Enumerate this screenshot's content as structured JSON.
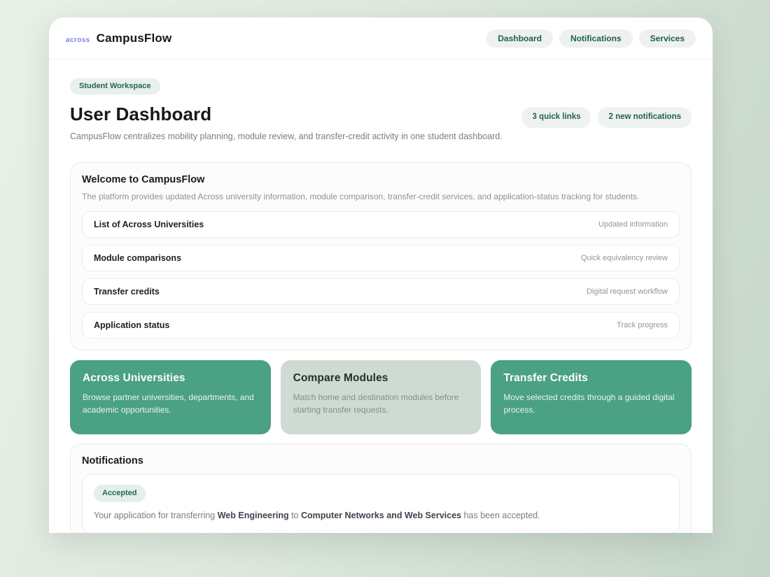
{
  "theme": {
    "accent_green": "#4aa183",
    "muted_sage": "#cedbd2",
    "pill_text": "#1f5f52",
    "page_background_start": "#e9f0e7",
    "page_background_end": "#c4d5c8"
  },
  "header": {
    "logo_mark": "across",
    "logo_title": "CampusFlow",
    "nav": [
      {
        "label": "Dashboard"
      },
      {
        "label": "Notifications"
      },
      {
        "label": "Services"
      }
    ]
  },
  "hero": {
    "workspace_badge": "Student Workspace",
    "title": "User Dashboard",
    "subtitle": "CampusFlow centralizes mobility planning, module review, and transfer-credit activity in one student dashboard.",
    "badges": [
      {
        "label": "3 quick links"
      },
      {
        "label": "2 new notifications"
      }
    ]
  },
  "welcome": {
    "title": "Welcome to CampusFlow",
    "description": "The platform provides updated Across university information, module comparison, transfer-credit services, and application-status tracking for students.",
    "items": [
      {
        "label": "List of Across Universities",
        "meta": "Updated information"
      },
      {
        "label": "Module comparisons",
        "meta": "Quick equivalency review"
      },
      {
        "label": "Transfer credits",
        "meta": "Digital request workflow"
      },
      {
        "label": "Application status",
        "meta": "Track progress"
      }
    ]
  },
  "feature_cards": [
    {
      "title": "Across Universities",
      "description": "Browse partner universities, departments, and academic opportunities.",
      "variant": "solid"
    },
    {
      "title": "Compare Modules",
      "description": "Match home and destination modules before starting transfer requests.",
      "variant": "muted"
    },
    {
      "title": "Transfer Credits",
      "description": "Move selected credits through a guided digital process.",
      "variant": "solid"
    }
  ],
  "notifications": {
    "title": "Notifications",
    "items": [
      {
        "status": "Accepted",
        "message_parts": [
          {
            "text": "Your application for transferring ",
            "bold": false
          },
          {
            "text": "Web Engineering",
            "bold": true
          },
          {
            "text": " to ",
            "bold": false
          },
          {
            "text": "Computer Networks and Web Services",
            "bold": true
          },
          {
            "text": " has been accepted.",
            "bold": false
          }
        ]
      }
    ]
  }
}
